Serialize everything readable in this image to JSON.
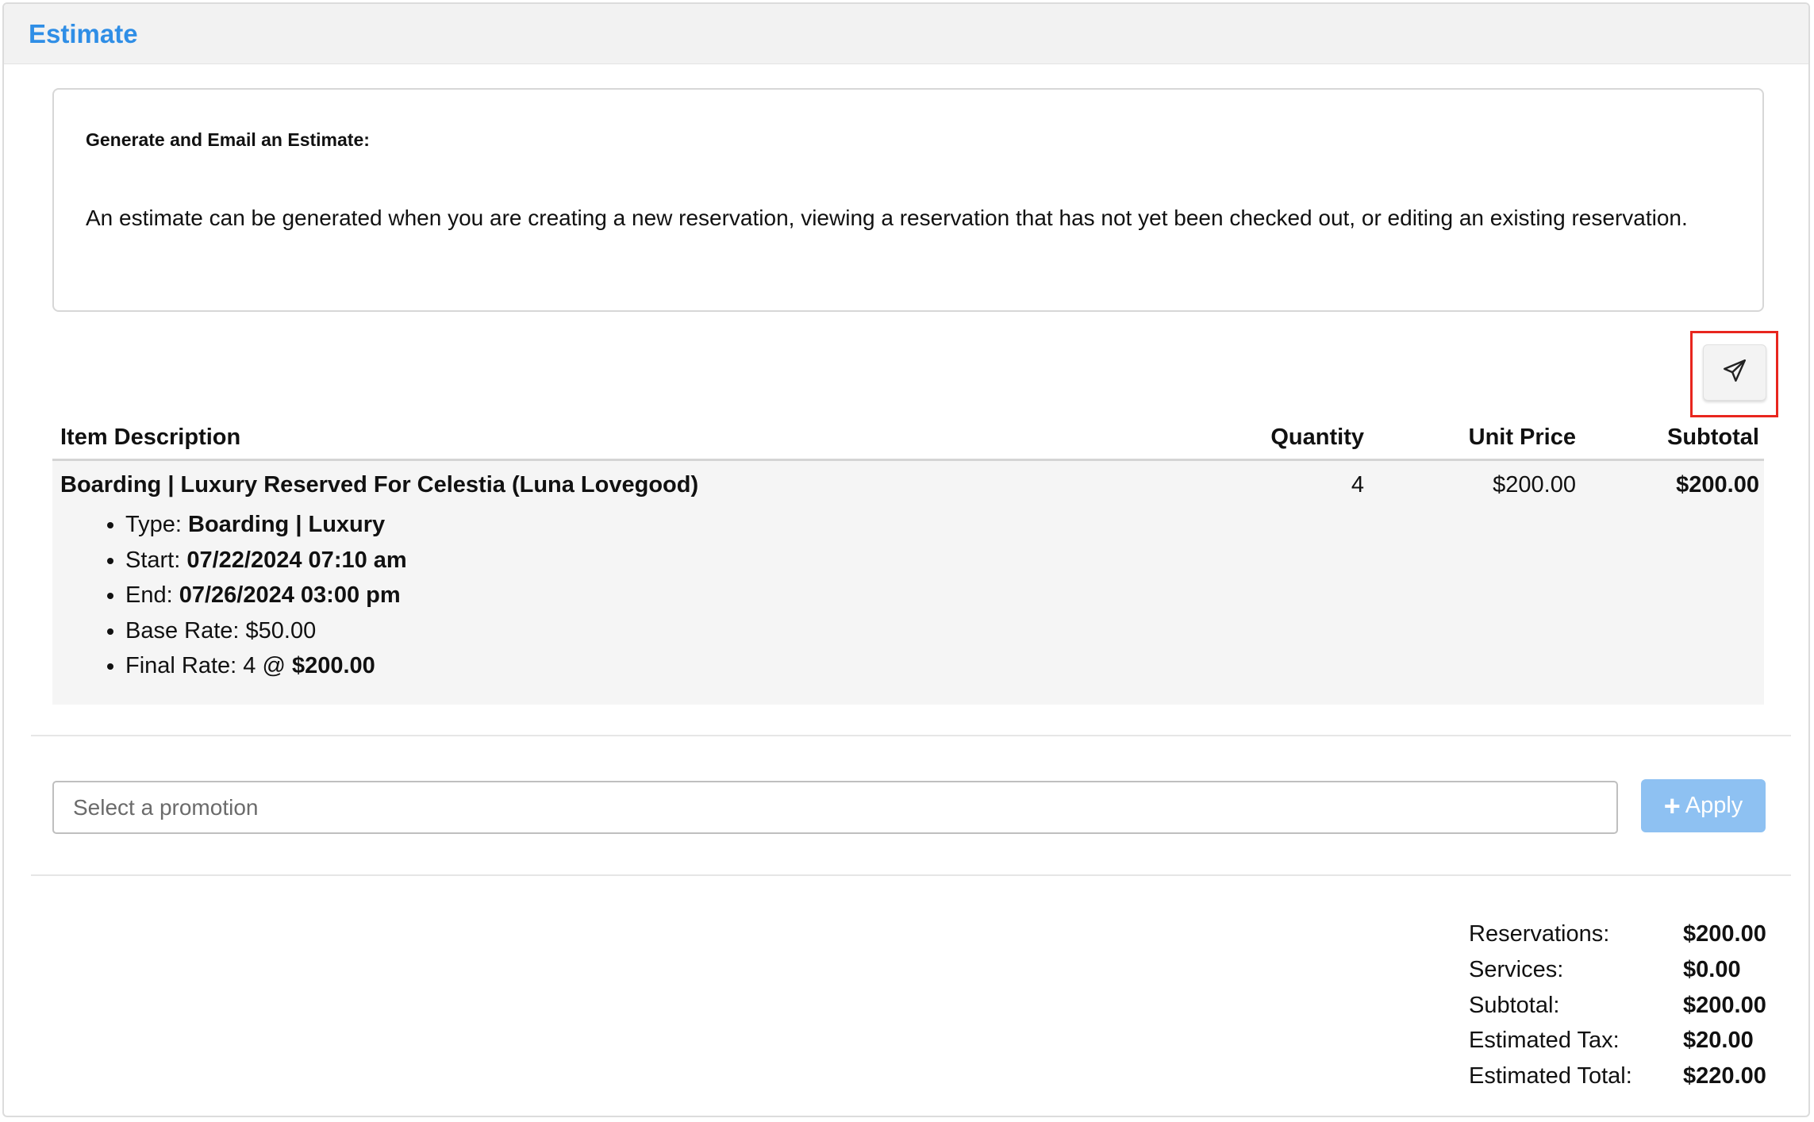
{
  "panel": {
    "title": "Estimate"
  },
  "info": {
    "heading": "Generate and Email an Estimate:",
    "text": "An estimate can be generated when you are creating a new reservation, viewing a reservation that has not yet been checked out, or editing an existing reservation."
  },
  "toolbar": {
    "send_icon": "paper-plane-icon",
    "highlight_color": "#e8261e"
  },
  "table": {
    "headers": {
      "description": "Item Description",
      "quantity": "Quantity",
      "unit_price": "Unit Price",
      "subtotal": "Subtotal"
    },
    "rows": [
      {
        "title": "Boarding | Luxury Reserved For Celestia (Luna Lovegood)",
        "quantity": "4",
        "unit_price": "$200.00",
        "subtotal": "$200.00",
        "details": {
          "type_label": "Type: ",
          "type_value": "Boarding | Luxury",
          "start_label": "Start: ",
          "start_value": "07/22/2024 07:10 am",
          "end_label": "End: ",
          "end_value": "07/26/2024 03:00 pm",
          "base_rate_label": "Base Rate: ",
          "base_rate_value": "$50.00",
          "final_rate_label": "Final Rate: ",
          "final_rate_qty": "4 @ ",
          "final_rate_value": "$200.00"
        }
      }
    ]
  },
  "promotion": {
    "placeholder": "Select a promotion",
    "apply_label": "Apply",
    "apply_color": "#8ec1f2"
  },
  "totals": {
    "reservations_label": "Reservations:",
    "reservations_value": "$200.00",
    "services_label": "Services:",
    "services_value": "$0.00",
    "subtotal_label": "Subtotal:",
    "subtotal_value": "$200.00",
    "tax_label": "Estimated Tax:",
    "tax_value": "$20.00",
    "total_label": "Estimated Total:",
    "total_value": "$220.00"
  },
  "colors": {
    "title": "#2f8ee6",
    "header_bg": "#f2f2f2",
    "row_bg": "#f5f5f5"
  }
}
